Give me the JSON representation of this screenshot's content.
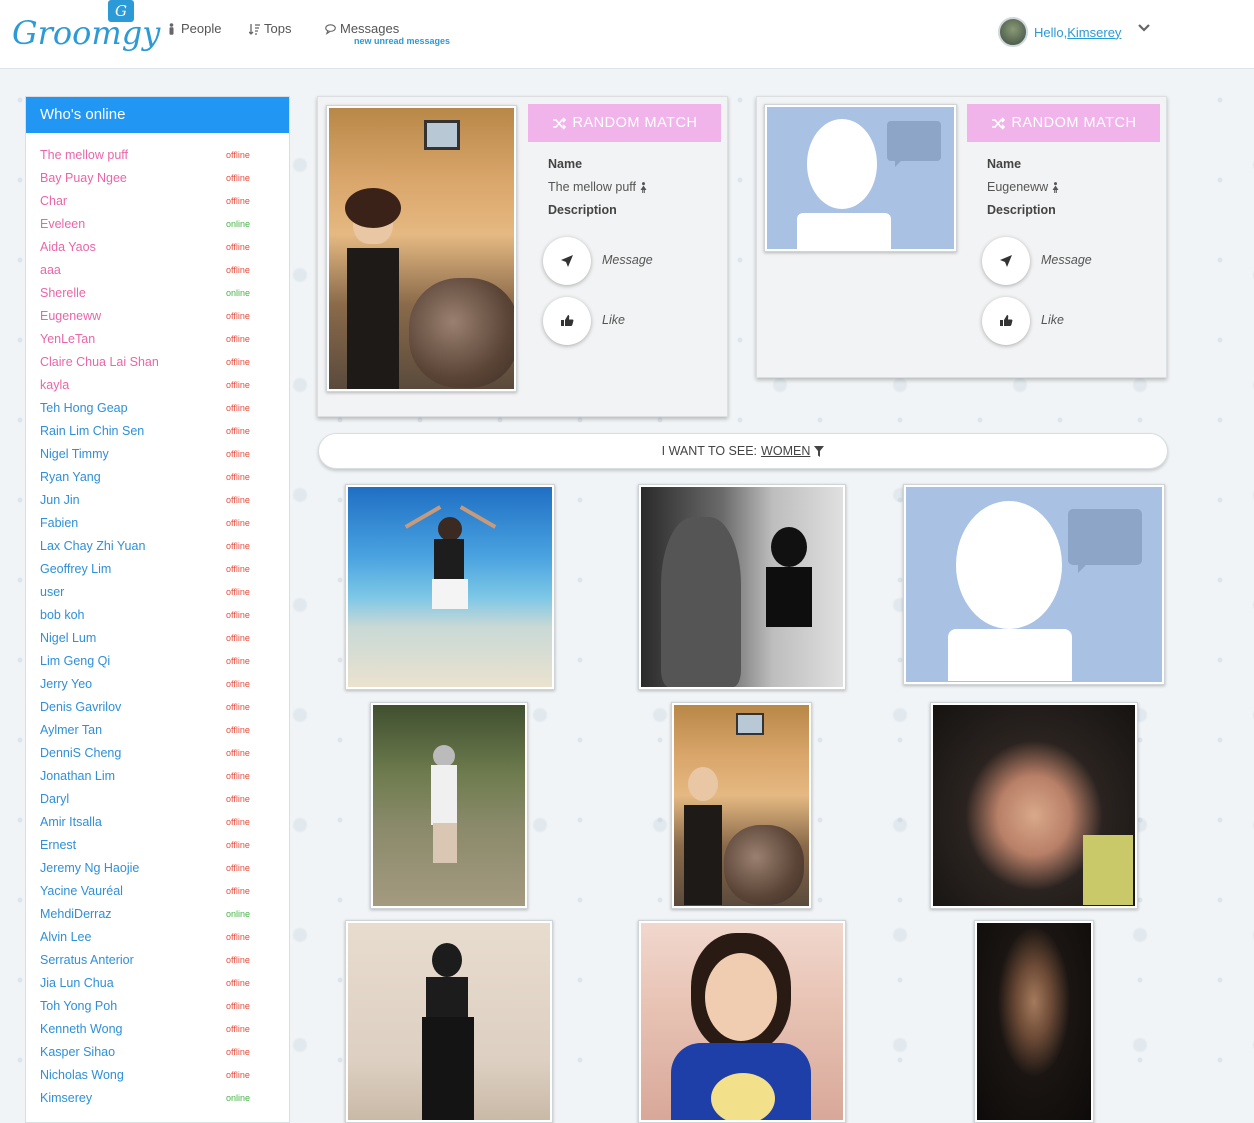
{
  "header": {
    "logo": "Groomgy",
    "logo_badge": "G",
    "nav": [
      {
        "label": "People",
        "icon": "person-icon"
      },
      {
        "label": "Tops",
        "icon": "sort-icon"
      },
      {
        "label": "Messages",
        "icon": "chat-icon",
        "sub": "new unread messages"
      }
    ],
    "greeting": "Hello, ",
    "user_name": "Kimserey"
  },
  "sidebar": {
    "title": "Who's online",
    "users": [
      {
        "name": "The mellow puff",
        "status": "offline",
        "gender": "f"
      },
      {
        "name": "Bay Puay Ngee",
        "status": "offline",
        "gender": "f"
      },
      {
        "name": "Char",
        "status": "offline",
        "gender": "f"
      },
      {
        "name": "Eveleen",
        "status": "online",
        "gender": "f"
      },
      {
        "name": "Aida Yaos",
        "status": "offline",
        "gender": "f"
      },
      {
        "name": "aaa",
        "status": "offline",
        "gender": "f"
      },
      {
        "name": "Sherelle",
        "status": "online",
        "gender": "f"
      },
      {
        "name": "Eugeneww",
        "status": "offline",
        "gender": "f"
      },
      {
        "name": "YenLeTan",
        "status": "offline",
        "gender": "f"
      },
      {
        "name": "Claire Chua Lai Shan",
        "status": "offline",
        "gender": "f"
      },
      {
        "name": "kayla",
        "status": "offline",
        "gender": "f"
      },
      {
        "name": "Teh Hong Geap",
        "status": "offline",
        "gender": "m"
      },
      {
        "name": "Rain Lim Chin Sen",
        "status": "offline",
        "gender": "m"
      },
      {
        "name": "Nigel Timmy",
        "status": "offline",
        "gender": "m"
      },
      {
        "name": "Ryan Yang",
        "status": "offline",
        "gender": "m"
      },
      {
        "name": "Jun Jin",
        "status": "offline",
        "gender": "m"
      },
      {
        "name": "Fabien",
        "status": "offline",
        "gender": "m"
      },
      {
        "name": "Lax Chay Zhi Yuan",
        "status": "offline",
        "gender": "m"
      },
      {
        "name": "Geoffrey Lim",
        "status": "offline",
        "gender": "m"
      },
      {
        "name": "user",
        "status": "offline",
        "gender": "m"
      },
      {
        "name": "bob koh",
        "status": "offline",
        "gender": "m"
      },
      {
        "name": "Nigel Lum",
        "status": "offline",
        "gender": "m"
      },
      {
        "name": "Lim Geng Qi",
        "status": "offline",
        "gender": "m"
      },
      {
        "name": "Jerry Yeo",
        "status": "offline",
        "gender": "m"
      },
      {
        "name": "Denis Gavrilov",
        "status": "offline",
        "gender": "m"
      },
      {
        "name": "Aylmer Tan",
        "status": "offline",
        "gender": "m"
      },
      {
        "name": "DenniS Cheng",
        "status": "offline",
        "gender": "m"
      },
      {
        "name": "Jonathan Lim",
        "status": "offline",
        "gender": "m"
      },
      {
        "name": "Daryl",
        "status": "offline",
        "gender": "m"
      },
      {
        "name": "Amir Itsalla",
        "status": "offline",
        "gender": "m"
      },
      {
        "name": "Ernest",
        "status": "offline",
        "gender": "m"
      },
      {
        "name": "Jeremy Ng Haojie",
        "status": "offline",
        "gender": "m"
      },
      {
        "name": "Yacine Vauréal",
        "status": "offline",
        "gender": "m"
      },
      {
        "name": "MehdiDerraz",
        "status": "online",
        "gender": "m"
      },
      {
        "name": "Alvin Lee",
        "status": "offline",
        "gender": "m"
      },
      {
        "name": "Serratus Anterior",
        "status": "offline",
        "gender": "m"
      },
      {
        "name": "Jia Lun Chua",
        "status": "offline",
        "gender": "m"
      },
      {
        "name": "Toh Yong Poh",
        "status": "offline",
        "gender": "m"
      },
      {
        "name": "Kenneth Wong",
        "status": "offline",
        "gender": "m"
      },
      {
        "name": "Kasper Sihao",
        "status": "offline",
        "gender": "m"
      },
      {
        "name": "Nicholas Wong",
        "status": "offline",
        "gender": "m"
      },
      {
        "name": "Kimserey",
        "status": "online",
        "gender": "m"
      }
    ]
  },
  "match_cards": [
    {
      "random_label": "RANDOM MATCH",
      "name_label": "Name",
      "name": "The mellow puff",
      "description_label": "Description",
      "message_label": "Message",
      "like_label": "Like"
    },
    {
      "random_label": "RANDOM MATCH",
      "name_label": "Name",
      "name": "Eugeneww",
      "description_label": "Description",
      "message_label": "Message",
      "like_label": "Like"
    }
  ],
  "filter": {
    "prefix": "I WANT TO SEE: ",
    "value": "WOMEN"
  },
  "colors": {
    "brand": "#2c9ad6",
    "sidebar_header": "#2196f3",
    "random_match": "#f0b4ea",
    "offline": "#e84c3d",
    "online": "#47b447",
    "female_name": "#e966a8",
    "male_name": "#2f8fd8",
    "placeholder": "#a9c1e3"
  }
}
